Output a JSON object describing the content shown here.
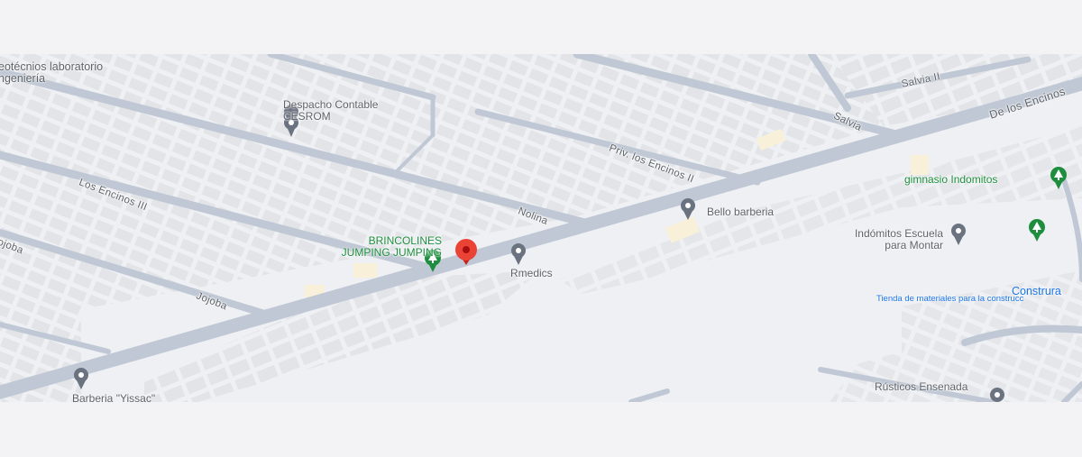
{
  "colors": {
    "background": "#f3f3f5",
    "map_base": "#eef0f3",
    "road": "#bfc8d4",
    "building": "#e2e4e8",
    "poi_gray": "#5f6368",
    "poi_green": "#1e8e3e",
    "poi_blue": "#1a73e8",
    "selected_pin": "#ea4335",
    "sand": "#f8f0d8"
  },
  "streets": {
    "los_encinos_iii": "Los Encinos III",
    "nolina": "Nolina",
    "jojoba_left": "Jojoba",
    "jojoba": "Jojoba",
    "priv_los_encinos_ii": "Priv. los Encinos II",
    "salvia": "Salvia",
    "salvia_ii": "Salvia II",
    "de_los_encinos": "De los Encinos"
  },
  "places": {
    "geotecnicos_line1": "eotécnios laboratorio",
    "geotecnicos_line2": "ngeniería",
    "despacho_line1": "Despacho Contable",
    "despacho_line2": "CESROM",
    "brincolines_line1": "BRINCOLINES",
    "brincolines_line2": "JUMPING JUMPING",
    "rmedics": "Rmedics",
    "bello_barberia": "Bello  barberia",
    "gimnasio": "gimnasio Indomitos",
    "indomitos_line1": "Indómitos Escuela",
    "indomitos_line2": "para Montar",
    "construra": "Construra",
    "tienda": "Tienda de materiales para la construcc",
    "barberia_yissac": "Barberia \"Yissac\"",
    "rusticos": "Rústicos Ensenada"
  },
  "icons": {
    "gray_pin": "location-pin-icon",
    "green_pin": "park-icon",
    "red_pin": "selected-location-icon"
  }
}
